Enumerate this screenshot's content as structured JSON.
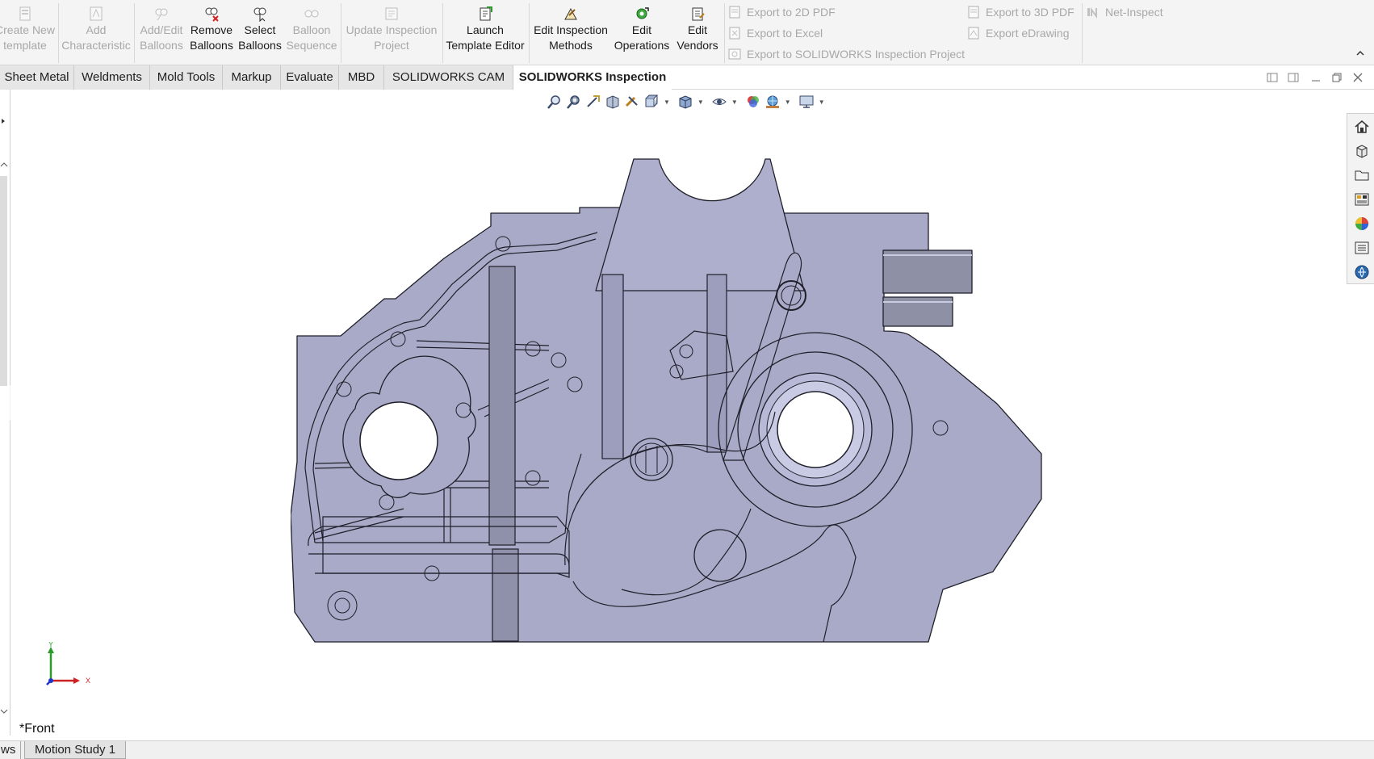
{
  "ribbon": {
    "buttons": [
      {
        "label": "Create New\ntemplate",
        "icon": "create-template-icon",
        "enabled": false
      },
      {
        "label": "Add\nCharacteristic",
        "icon": "add-characteristic-icon",
        "enabled": false
      },
      {
        "label": "Add/Edit\nBalloons",
        "icon": "edit-balloons-icon",
        "enabled": false
      },
      {
        "label": "Remove\nBalloons",
        "icon": "remove-balloons-icon",
        "enabled": true
      },
      {
        "label": "Select\nBalloons",
        "icon": "select-balloons-icon",
        "enabled": true
      },
      {
        "label": "Balloon\nSequence",
        "icon": "balloon-sequence-icon",
        "enabled": false
      },
      {
        "label": "Update Inspection\nProject",
        "icon": "update-project-icon",
        "enabled": false
      },
      {
        "label": "Launch\nTemplate Editor",
        "icon": "template-editor-icon",
        "enabled": true
      },
      {
        "label": "Edit Inspection\nMethods",
        "icon": "inspection-methods-icon",
        "enabled": true
      },
      {
        "label": "Edit\nOperations",
        "icon": "operations-icon",
        "enabled": true
      },
      {
        "label": "Edit\nVendors",
        "icon": "vendors-icon",
        "enabled": true
      }
    ],
    "exports_left": [
      "Export to 2D PDF",
      "Export to Excel",
      "Export to SOLIDWORKS Inspection Project"
    ],
    "exports_right": [
      "Export to 3D PDF",
      "Export eDrawing"
    ],
    "net_inspect": "Net-Inspect"
  },
  "tabs": [
    "Sheet Metal",
    "Weldments",
    "Mold Tools",
    "Markup",
    "Evaluate",
    "MBD",
    "SOLIDWORKS CAM",
    "SOLIDWORKS Inspection"
  ],
  "active_tab": "SOLIDWORKS Inspection",
  "viewport": {
    "view_name": "*Front",
    "axis_y": "Y",
    "axis_x": "X",
    "colors": {
      "part_fill": "#a9aac8",
      "part_edge": "#1f1f2a",
      "cylinder": "#8d8fa4"
    }
  },
  "heads_up_toolbar": [
    "zoom-to-fit-icon",
    "zoom-to-area-icon",
    "previous-view-icon",
    "section-view-icon",
    "dynamic-annotation-icon",
    "view-orientation-icon",
    "display-style-icon",
    "hide-show-icon",
    "edit-appearance-icon",
    "apply-scene-icon",
    "view-settings-icon"
  ],
  "task_pane": [
    "home-icon",
    "design-library-icon",
    "file-explorer-icon",
    "view-palette-icon",
    "appearances-icon",
    "custom-properties-icon",
    "solidworks-forum-icon"
  ],
  "bottom_tabs": {
    "left": "ws",
    "motion_study": "Motion Study 1"
  }
}
